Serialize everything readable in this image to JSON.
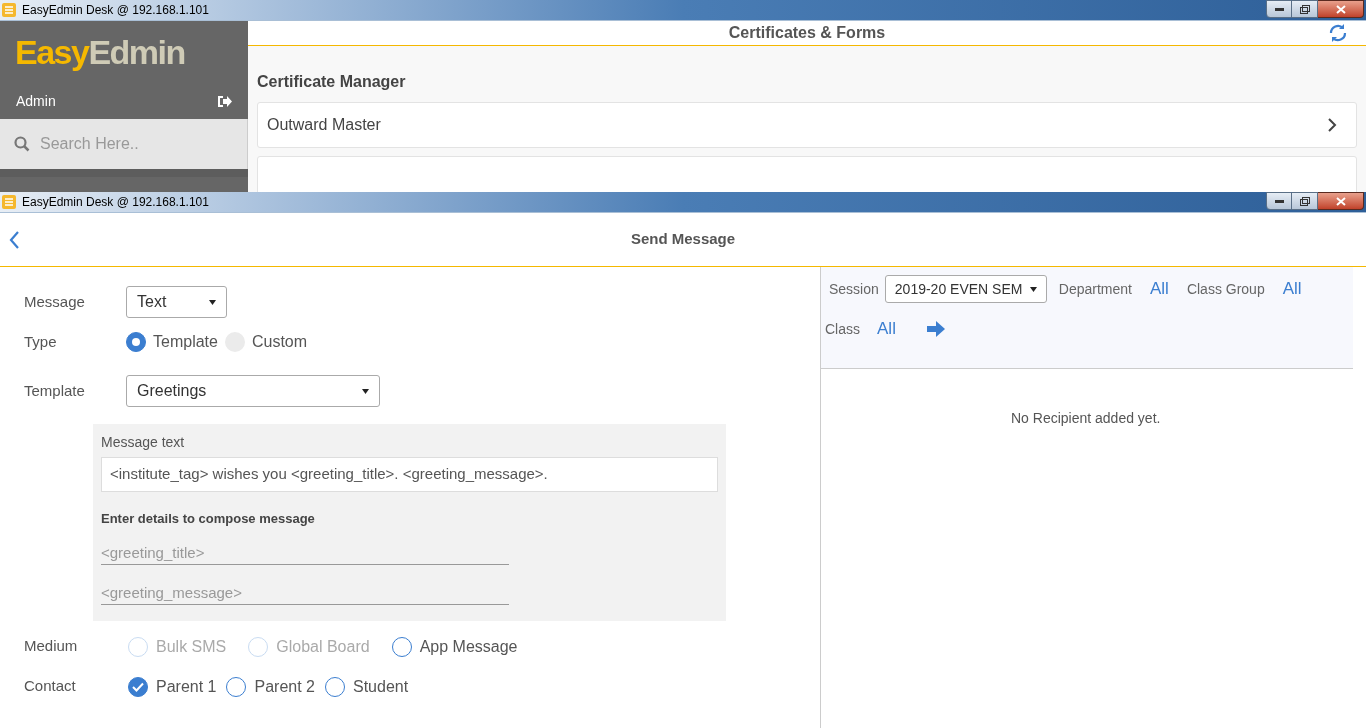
{
  "back_window": {
    "title": "EasyEdmin Desk @ 192.168.1.101",
    "logo": {
      "first": "Easy",
      "second": "Edmin"
    },
    "user": "Admin",
    "search": {
      "placeholder": "Search Here.."
    },
    "header": {
      "title": "Certificates & Forms"
    },
    "section_heading": "Certificate Manager",
    "items": [
      {
        "label": "Outward Master"
      }
    ]
  },
  "front_window": {
    "title": "EasyEdmin Desk @ 192.168.1.101",
    "header": {
      "title": "Send Message"
    },
    "form": {
      "message": {
        "label": "Message",
        "value": "Text"
      },
      "type": {
        "label": "Type",
        "options": [
          {
            "label": "Template",
            "selected": true
          },
          {
            "label": "Custom",
            "selected": false
          }
        ]
      },
      "template": {
        "label": "Template",
        "value": "Greetings"
      },
      "message_text": {
        "label": "Message text",
        "value": "<institute_tag> wishes you <greeting_title>. <greeting_message>."
      },
      "compose_heading": "Enter details to compose message",
      "compose_fields": [
        {
          "placeholder": "<greeting_title>"
        },
        {
          "placeholder": "<greeting_message>"
        }
      ],
      "medium": {
        "label": "Medium",
        "options": [
          {
            "label": "Bulk SMS",
            "selected": false,
            "disabled": true
          },
          {
            "label": "Global Board",
            "selected": false,
            "disabled": true
          },
          {
            "label": "App Message",
            "selected": false,
            "disabled": false
          }
        ]
      },
      "contact": {
        "label": "Contact",
        "options": [
          {
            "label": "Parent 1",
            "checked": true
          },
          {
            "label": "Parent 2",
            "checked": false
          },
          {
            "label": "Student",
            "checked": false
          }
        ]
      }
    },
    "recipients": {
      "session": {
        "label": "Session",
        "value": "2019-20 EVEN SEM"
      },
      "department": {
        "label": "Department",
        "value": "All"
      },
      "class_group": {
        "label": "Class Group",
        "value": "All"
      },
      "class": {
        "label": "Class",
        "value": "All"
      },
      "empty_message": "No Recipient added yet."
    }
  }
}
